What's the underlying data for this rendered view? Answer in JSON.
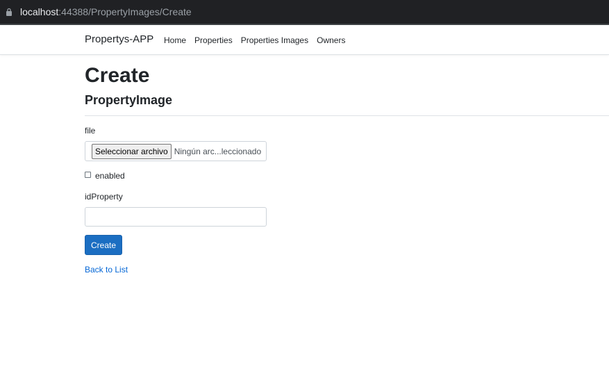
{
  "browser": {
    "url_host": "localhost",
    "url_rest": ":44388/PropertyImages/Create"
  },
  "navbar": {
    "brand": "Propertys-APP",
    "links": [
      "Home",
      "Properties",
      "Properties Images",
      "Owners"
    ]
  },
  "main": {
    "title": "Create",
    "subtitle": "PropertyImage",
    "fields": {
      "file_label": "file",
      "file_button": "Seleccionar archivo",
      "file_status": "Ningún arc...leccionado",
      "enabled_label": "enabled",
      "enabled_checked": false,
      "idproperty_label": "idProperty",
      "idproperty_value": ""
    },
    "submit_label": "Create",
    "back_link": "Back to List"
  },
  "colors": {
    "primary": "#1b6ec2",
    "link": "#0366d6",
    "addressbar": "#202124"
  }
}
